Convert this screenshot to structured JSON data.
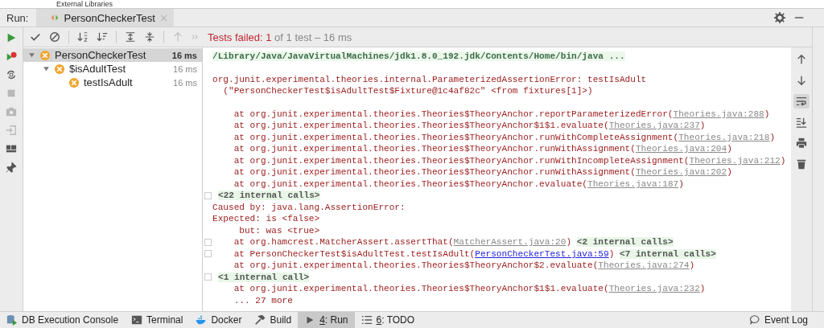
{
  "top_strip": {
    "text": "External Libraries"
  },
  "run_bar": {
    "label": "Run:",
    "tabs": [
      {
        "label": "PersonCheckerTest",
        "selected": true
      }
    ]
  },
  "left_toolbar": [
    {
      "kind": "run",
      "disabled": false
    },
    {
      "kind": "rerun",
      "disabled": false
    },
    {
      "kind": "auto",
      "disabled": false
    },
    {
      "kind": "stop",
      "disabled": true
    },
    {
      "kind": "camera",
      "disabled": true
    },
    {
      "kind": "exit",
      "disabled": true
    },
    {
      "kind": "layout",
      "disabled": false
    },
    {
      "kind": "pin",
      "disabled": false
    }
  ],
  "toolbar": {
    "buttons": [
      {
        "kind": "check",
        "disabled": false
      },
      {
        "kind": "ignore",
        "disabled": false
      },
      {
        "kind": "sort-alpha",
        "disabled": false
      },
      {
        "kind": "sort-duration",
        "disabled": false
      },
      {
        "kind": "expand",
        "disabled": false
      },
      {
        "kind": "collapse",
        "disabled": false
      },
      {
        "kind": "up",
        "disabled": true
      }
    ],
    "status": {
      "failed": "Tests failed: 1",
      "summary": "of 1 test – 16 ms"
    }
  },
  "tree": [
    {
      "label": "PersonCheckerTest",
      "time": "16 ms",
      "failed": true,
      "selected": true,
      "expanded": true,
      "children": [
        {
          "label": "$isAdultTest",
          "time": "16 ms",
          "failed": true,
          "selected": false,
          "expanded": true,
          "children": [
            {
              "label": "testIsAdult",
              "time": "16 ms",
              "failed": true,
              "selected": false
            }
          ]
        }
      ]
    }
  ],
  "console": {
    "blocks": [
      [
        {
          "kind": "command",
          "segments": [
            {
              "kind": "text",
              "text": "/Library/Java/JavaVirtualMachines/jdk1.8.0_192.jdk/Contents/Home/bin/java ..."
            }
          ]
        }
      ],
      [
        {
          "kind": "error",
          "segments": [
            {
              "kind": "text",
              "text": "org.junit.experimental.theories.internal.ParameterizedAssertionError: testIsAdult"
            }
          ]
        },
        {
          "kind": "error",
          "segments": [
            {
              "kind": "text",
              "text": "  (\"PersonCheckerTest$isAdultTest$Fixture@1c4af82c\" <from fixtures[1]>)"
            }
          ]
        }
      ],
      [
        {
          "kind": "error",
          "segments": [
            {
              "kind": "text",
              "text": "    at org.junit.experimental.theories.Theories$TheoryAnchor.reportParameterizedError("
            },
            {
              "kind": "library_link",
              "text": "Theories.java:288"
            },
            {
              "kind": "text",
              "text": ")"
            }
          ]
        },
        {
          "kind": "error",
          "segments": [
            {
              "kind": "text",
              "text": "    at org.junit.experimental.theories.Theories$TheoryAnchor$1$1.evaluate("
            },
            {
              "kind": "library_link",
              "text": "Theories.java:237"
            },
            {
              "kind": "text",
              "text": ")"
            }
          ]
        },
        {
          "kind": "error",
          "segments": [
            {
              "kind": "text",
              "text": "    at org.junit.experimental.theories.Theories$TheoryAnchor.runWithCompleteAssignment("
            },
            {
              "kind": "library_link",
              "text": "Theories.java:218"
            },
            {
              "kind": "text",
              "text": ")"
            }
          ]
        },
        {
          "kind": "error",
          "segments": [
            {
              "kind": "text",
              "text": "    at org.junit.experimental.theories.Theories$TheoryAnchor.runWithAssignment("
            },
            {
              "kind": "library_link",
              "text": "Theories.java:204"
            },
            {
              "kind": "text",
              "text": ")"
            }
          ]
        },
        {
          "kind": "error",
          "segments": [
            {
              "kind": "text",
              "text": "    at org.junit.experimental.theories.Theories$TheoryAnchor.runWithIncompleteAssignment("
            },
            {
              "kind": "library_link",
              "text": "Theories.java:212"
            },
            {
              "kind": "text",
              "text": ")"
            }
          ]
        },
        {
          "kind": "error",
          "segments": [
            {
              "kind": "text",
              "text": "    at org.junit.experimental.theories.Theories$TheoryAnchor.runWithAssignment("
            },
            {
              "kind": "library_link",
              "text": "Theories.java:202"
            },
            {
              "kind": "text",
              "text": ")"
            }
          ]
        },
        {
          "kind": "error",
          "segments": [
            {
              "kind": "text",
              "text": "    at org.junit.experimental.theories.Theories$TheoryAnchor.evaluate("
            },
            {
              "kind": "library_link",
              "text": "Theories.java:187"
            },
            {
              "kind": "text",
              "text": ")"
            }
          ]
        },
        {
          "kind": "error",
          "foldable": true,
          "segments": [
            {
              "kind": "internal",
              "text": "<22 internal calls>"
            }
          ]
        },
        {
          "kind": "error",
          "segments": [
            {
              "kind": "text",
              "text": "Caused by: java.lang.AssertionError:"
            }
          ]
        },
        {
          "kind": "error",
          "segments": [
            {
              "kind": "text",
              "text": "Expected: is <false>"
            }
          ]
        },
        {
          "kind": "error",
          "segments": [
            {
              "kind": "text",
              "text": "     but: was <true>"
            }
          ]
        },
        {
          "kind": "error",
          "foldable": true,
          "segments": [
            {
              "kind": "text",
              "text": "    at org.hamcrest.MatcherAssert.assertThat("
            },
            {
              "kind": "library_link",
              "text": "MatcherAssert.java:20"
            },
            {
              "kind": "text",
              "text": ") "
            },
            {
              "kind": "internal",
              "text": "<2 internal calls>"
            }
          ]
        },
        {
          "kind": "error",
          "foldable": true,
          "segments": [
            {
              "kind": "text",
              "text": "    at PersonCheckerTest$isAdultTest.testIsAdult("
            },
            {
              "kind": "source_link",
              "text": "PersonCheckerTest.java:59"
            },
            {
              "kind": "text",
              "text": ") "
            },
            {
              "kind": "internal",
              "text": "<7 internal calls>"
            }
          ]
        },
        {
          "kind": "error",
          "segments": [
            {
              "kind": "text",
              "text": "    at org.junit.experimental.theories.Theories$TheoryAnchor$2.evaluate("
            },
            {
              "kind": "library_link",
              "text": "Theories.java:274"
            },
            {
              "kind": "text",
              "text": ")"
            }
          ]
        },
        {
          "kind": "error",
          "foldable": true,
          "segments": [
            {
              "kind": "internal",
              "text": "<1 internal call>"
            }
          ]
        },
        {
          "kind": "error",
          "segments": [
            {
              "kind": "text",
              "text": "    at org.junit.experimental.theories.Theories$TheoryAnchor$1$1.evaluate("
            },
            {
              "kind": "library_link",
              "text": "Theories.java:232"
            },
            {
              "kind": "text",
              "text": ")"
            }
          ]
        },
        {
          "kind": "error",
          "segments": [
            {
              "kind": "text",
              "text": "    ... 27 more"
            }
          ]
        }
      ]
    ]
  },
  "right_toolbar": [
    {
      "kind": "up",
      "selected": false
    },
    {
      "kind": "down",
      "selected": false
    },
    {
      "kind": "wrap",
      "selected": true
    },
    {
      "kind": "scroll-end",
      "selected": false
    },
    {
      "kind": "print",
      "selected": false
    },
    {
      "kind": "trash",
      "selected": false
    }
  ],
  "status_bar": {
    "items": [
      {
        "kind": "db",
        "label": "DB Execution Console",
        "mnemonic": false,
        "selected": false
      },
      {
        "kind": "terminal",
        "label": "Terminal",
        "mnemonic": false,
        "selected": false
      },
      {
        "kind": "docker",
        "label": "Docker",
        "mnemonic": false,
        "selected": false
      },
      {
        "kind": "build",
        "label": "Build",
        "mnemonic": false,
        "selected": false
      },
      {
        "kind": "run",
        "label": "4: Run",
        "mnemonic": true,
        "selected": true
      },
      {
        "kind": "todo",
        "label": "6: TODO",
        "mnemonic": true,
        "selected": false
      }
    ],
    "right": {
      "label": "Event Log"
    }
  }
}
